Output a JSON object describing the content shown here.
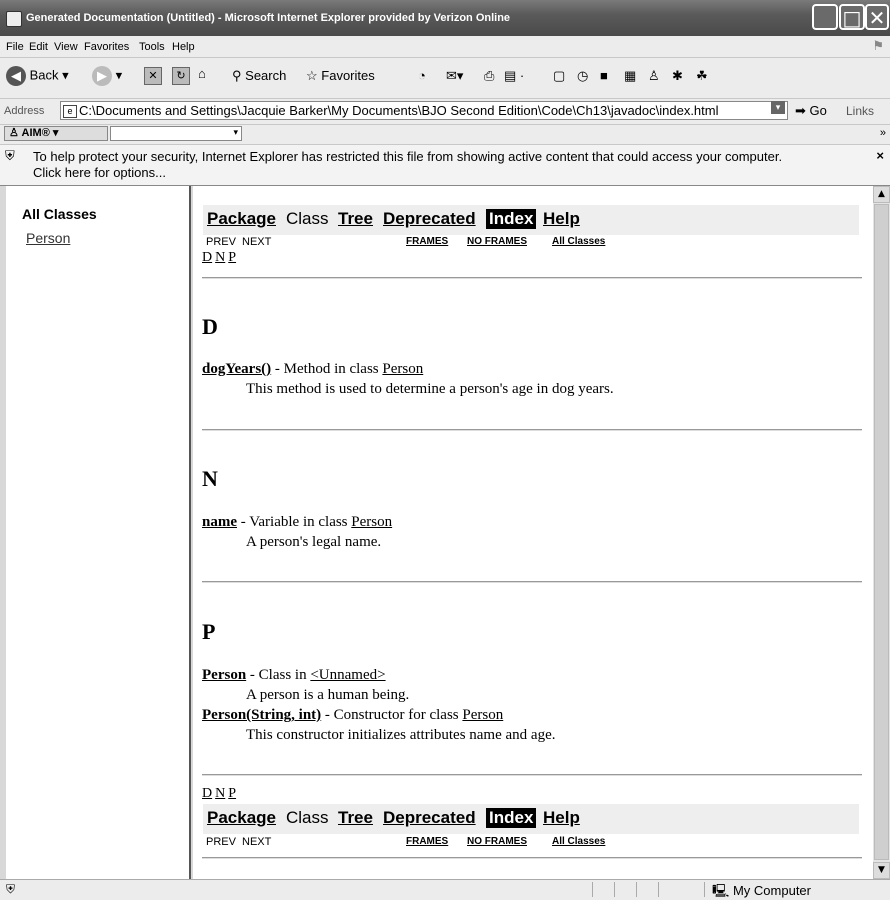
{
  "window": {
    "title": "Generated Documentation (Untitled) - Microsoft Internet Explorer provided by Verizon Online"
  },
  "menu": [
    "File",
    "Edit",
    "View",
    "Favorites",
    "Tools",
    "Help"
  ],
  "toolbar": {
    "back": "Back",
    "search": "Search",
    "favorites": "Favorites"
  },
  "address": {
    "label": "Address",
    "value": "C:\\Documents and Settings\\Jacquie Barker\\My Documents\\BJO Second Edition\\Code\\Ch13\\javadoc\\index.html",
    "go": "Go",
    "links": "Links"
  },
  "aim": {
    "label": "AIM®"
  },
  "infobar": {
    "line1": "To help protect your security, Internet Explorer has restricted this file from showing active content that could access your computer.",
    "line2": "Click here for options...",
    "close": "×"
  },
  "left": {
    "heading": "All Classes",
    "class_link": "Person"
  },
  "nav": {
    "package": "Package",
    "class": "Class",
    "tree": "Tree",
    "deprecated": "Deprecated",
    "index": "Index",
    "help": "Help",
    "prev": "PREV",
    "next": "NEXT",
    "frames": "FRAMES",
    "noframes": "NO FRAMES",
    "allclasses": "All Classes"
  },
  "letters": [
    "D",
    "N",
    "P"
  ],
  "sections": {
    "d": {
      "letter": "D",
      "e1_name": "dogYears()",
      "e1_kind": " - Method in class ",
      "e1_link": "Person",
      "e1_desc": "This method is used to determine a person's age in dog years."
    },
    "n": {
      "letter": "N",
      "e1_name": "name",
      "e1_kind": " - Variable in class ",
      "e1_link": "Person",
      "e1_desc": "A person's legal name."
    },
    "p": {
      "letter": "P",
      "e1_name": "Person",
      "e1_kind": " - Class in ",
      "e1_link": "<Unnamed>",
      "e1_desc": "A person is a human being.",
      "e2_name": "Person(String, int)",
      "e2_kind": " - Constructor for class ",
      "e2_link": "Person",
      "e2_desc": "This constructor initializes attributes name and age."
    }
  },
  "status": {
    "zone": "My Computer"
  }
}
